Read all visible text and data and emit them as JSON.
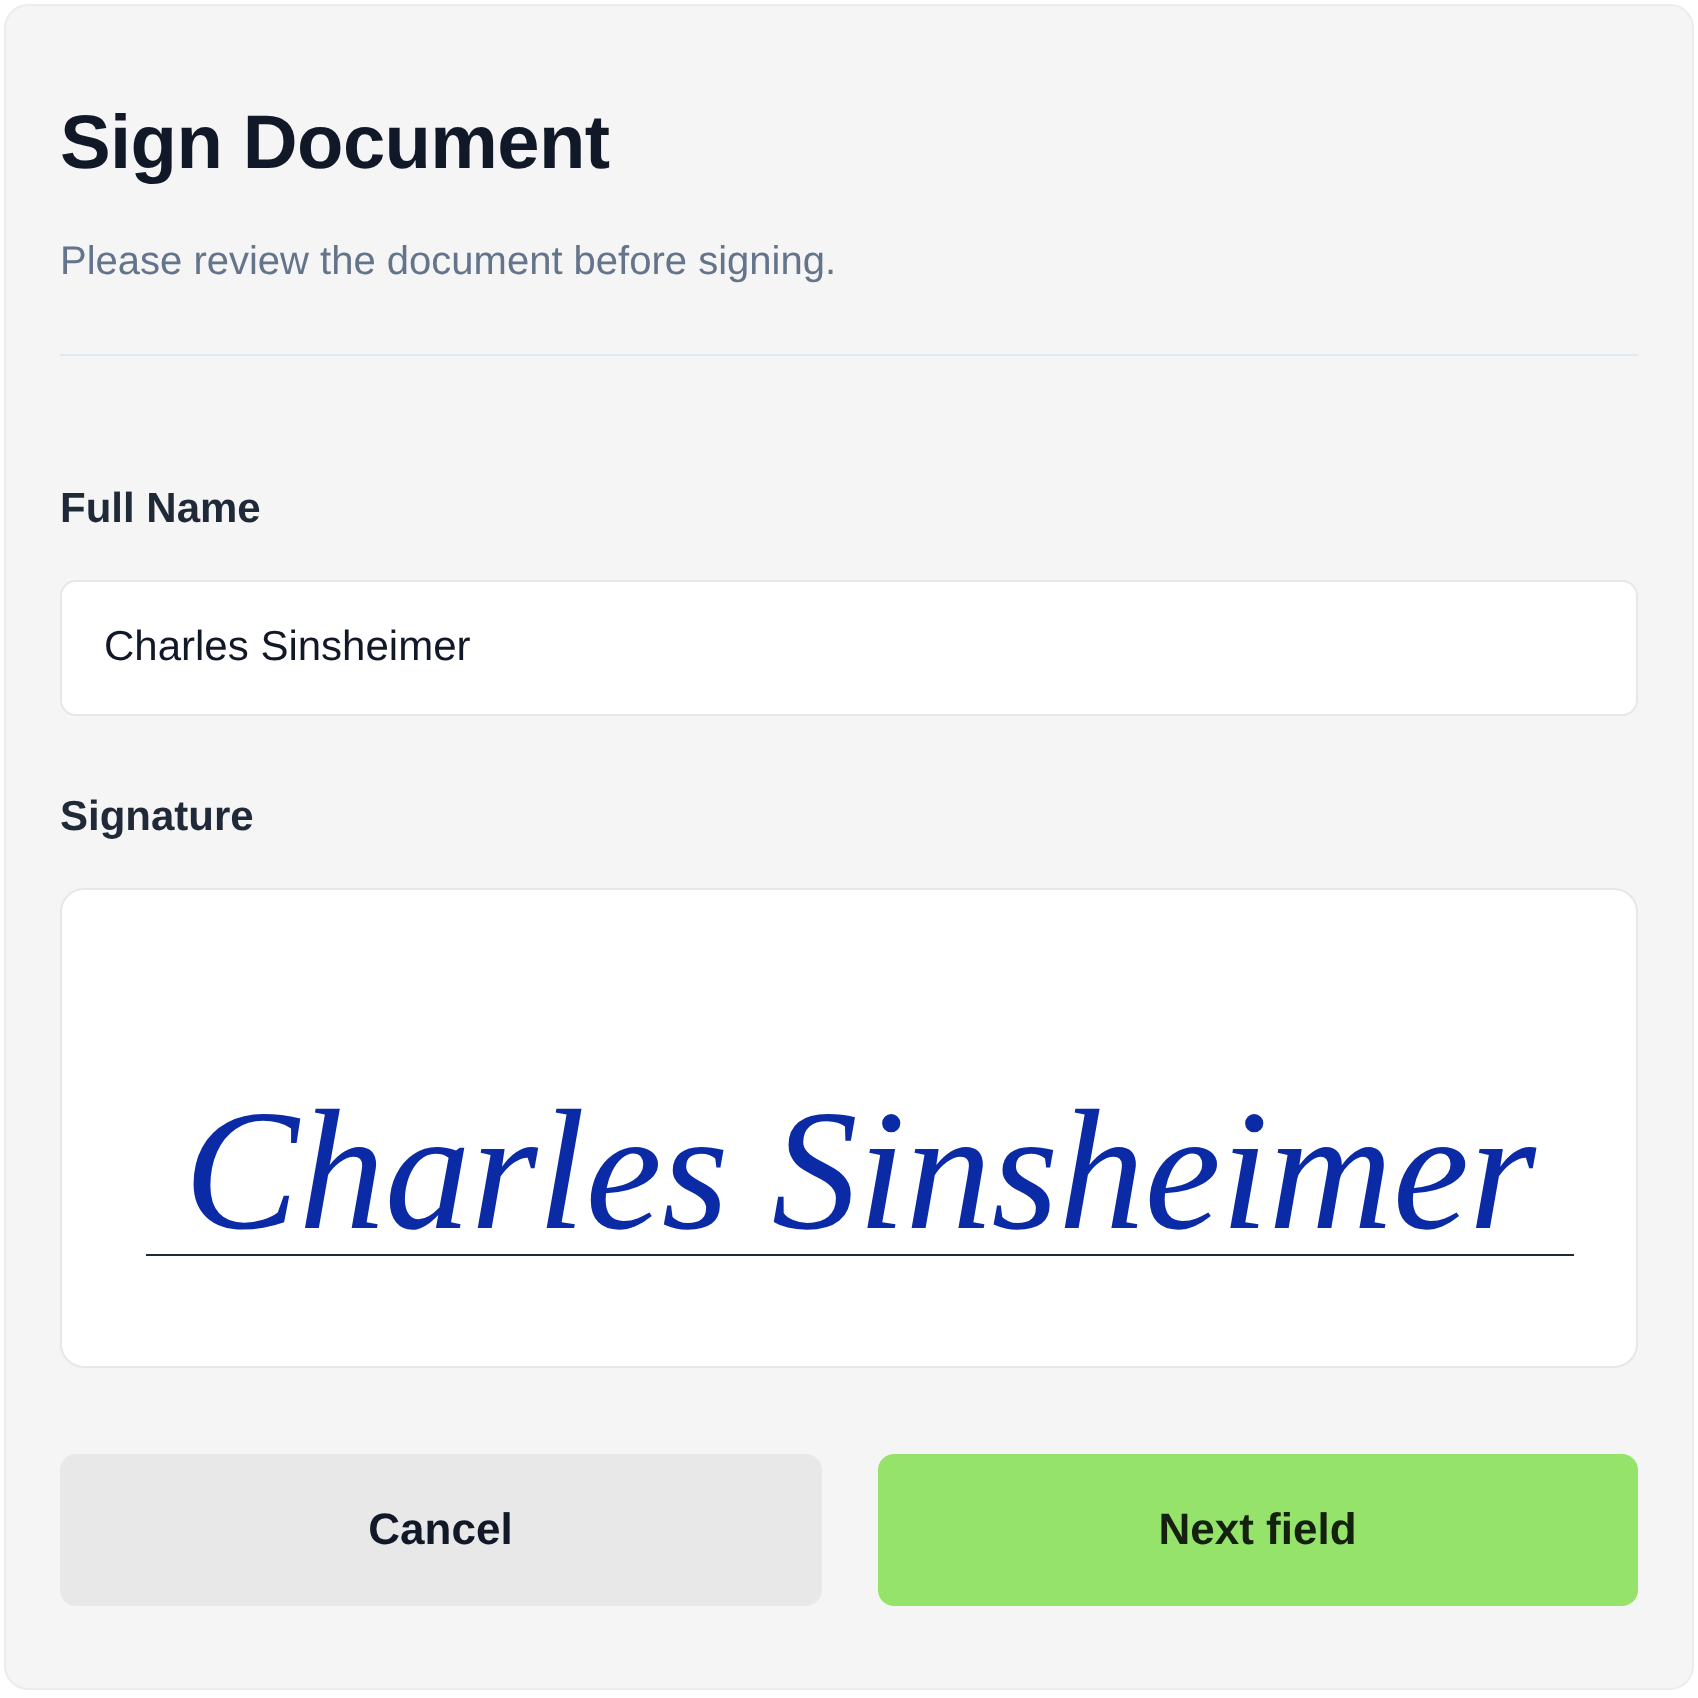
{
  "dialog": {
    "title": "Sign Document",
    "subtitle": "Please review the document before signing."
  },
  "fields": [
    {
      "kind": "text",
      "label": "Full Name",
      "value": "Charles Sinsheimer"
    },
    {
      "kind": "signature",
      "label": "Signature",
      "value": "Charles Sinsheimer"
    }
  ],
  "buttons": [
    {
      "kind": "secondary",
      "label": "Cancel"
    },
    {
      "kind": "primary",
      "label": "Next field"
    }
  ]
}
